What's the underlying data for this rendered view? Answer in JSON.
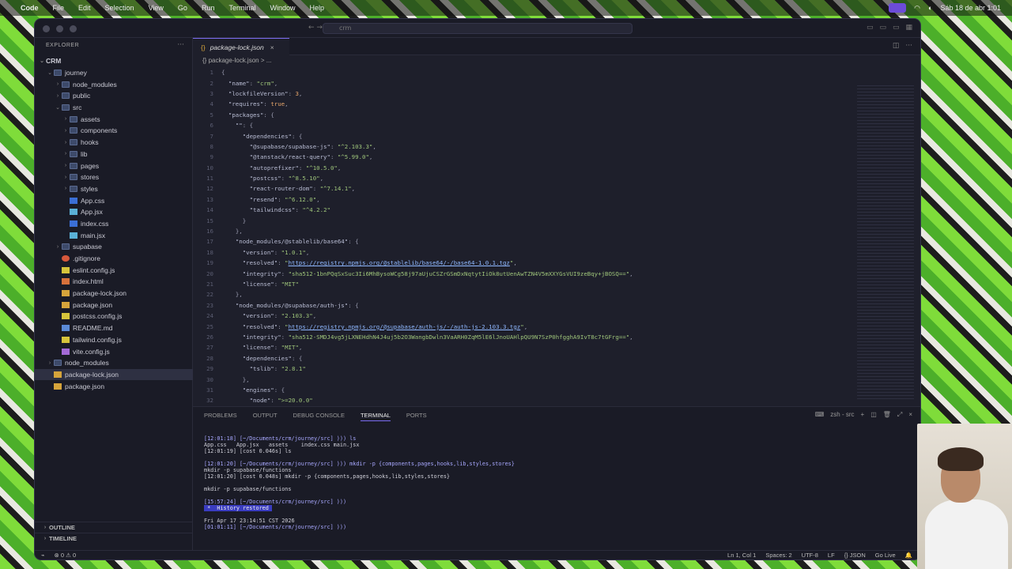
{
  "menubar": {
    "apple": "",
    "app": "Code",
    "items": [
      "File",
      "Edit",
      "Selection",
      "View",
      "Go",
      "Run",
      "Terminal",
      "Window",
      "Help"
    ],
    "clock": "Sáb 18 de abr  1:01"
  },
  "window": {
    "title": "crm",
    "nav_back": "←",
    "nav_fwd": "→"
  },
  "sidebar": {
    "header": "EXPLORER",
    "dots": "···",
    "root": "CRM",
    "rows": [
      {
        "label": "journey",
        "type": "folder",
        "depth": 1,
        "chev": "⌄"
      },
      {
        "label": "node_modules",
        "type": "folder",
        "depth": 2,
        "chev": "›"
      },
      {
        "label": "public",
        "type": "folder",
        "depth": 2,
        "chev": "›"
      },
      {
        "label": "src",
        "type": "folder",
        "depth": 2,
        "chev": "⌄"
      },
      {
        "label": "assets",
        "type": "folder",
        "depth": 3,
        "chev": "›"
      },
      {
        "label": "components",
        "type": "folder",
        "depth": 3,
        "chev": "›"
      },
      {
        "label": "hooks",
        "type": "folder",
        "depth": 3,
        "chev": "›"
      },
      {
        "label": "lib",
        "type": "folder",
        "depth": 3,
        "chev": "›"
      },
      {
        "label": "pages",
        "type": "folder",
        "depth": 3,
        "chev": "›"
      },
      {
        "label": "stores",
        "type": "folder",
        "depth": 3,
        "chev": "›"
      },
      {
        "label": "styles",
        "type": "folder",
        "depth": 3,
        "chev": "›"
      },
      {
        "label": "App.css",
        "type": "css",
        "depth": 3,
        "chev": ""
      },
      {
        "label": "App.jsx",
        "type": "jsx",
        "depth": 3,
        "chev": ""
      },
      {
        "label": "index.css",
        "type": "css",
        "depth": 3,
        "chev": ""
      },
      {
        "label": "main.jsx",
        "type": "jsx",
        "depth": 3,
        "chev": ""
      },
      {
        "label": "supabase",
        "type": "folder",
        "depth": 2,
        "chev": "›"
      },
      {
        "label": ".gitignore",
        "type": "git",
        "depth": 2,
        "chev": ""
      },
      {
        "label": "eslint.config.js",
        "type": "js",
        "depth": 2,
        "chev": ""
      },
      {
        "label": "index.html",
        "type": "html",
        "depth": 2,
        "chev": ""
      },
      {
        "label": "package-lock.json",
        "type": "json",
        "depth": 2,
        "chev": ""
      },
      {
        "label": "package.json",
        "type": "json",
        "depth": 2,
        "chev": ""
      },
      {
        "label": "postcss.config.js",
        "type": "js",
        "depth": 2,
        "chev": ""
      },
      {
        "label": "README.md",
        "type": "md",
        "depth": 2,
        "chev": ""
      },
      {
        "label": "tailwind.config.js",
        "type": "js",
        "depth": 2,
        "chev": ""
      },
      {
        "label": "vite.config.js",
        "type": "vite",
        "depth": 2,
        "chev": ""
      },
      {
        "label": "node_modules",
        "type": "folder",
        "depth": 1,
        "chev": "›"
      },
      {
        "label": "package-lock.json",
        "type": "json",
        "depth": 1,
        "chev": "",
        "selected": true
      },
      {
        "label": "package.json",
        "type": "json",
        "depth": 1,
        "chev": ""
      }
    ],
    "outline": "OUTLINE",
    "timeline": "TIMELINE"
  },
  "editor": {
    "tab_label": "package-lock.json",
    "tab_close": "×",
    "breadcrumb": "{} package-lock.json > ...",
    "lines": [
      "{",
      "  \"name\": \"crm\",",
      "  \"lockfileVersion\": 3,",
      "  \"requires\": true,",
      "  \"packages\": {",
      "    \"\": {",
      "      \"dependencies\": {",
      "        \"@supabase/supabase-js\": \"^2.103.3\",",
      "        \"@tanstack/react-query\": \"^5.99.0\",",
      "        \"autoprefixer\": \"^10.5.0\",",
      "        \"postcss\": \"^8.5.10\",",
      "        \"react-router-dom\": \"^7.14.1\",",
      "        \"resend\": \"^6.12.0\",",
      "        \"tailwindcss\": \"^4.2.2\"",
      "      }",
      "    },",
      "    \"node_modules/@stablelib/base64\": {",
      "      \"version\": \"1.0.1\",",
      "      \"resolved\": \"https://registry.npmjs.org/@stablelib/base64/-/base64-1.0.1.tgz\",",
      "      \"integrity\": \"sha512-1bnPQqSxSuc3Ii6MhBysoWCg58j97aUjuCSZrGSmDxNqtytIiOk8utUenAwTZN4V5mXXYGsVUI9zeBqy+jBOSQ==\",",
      "      \"license\": \"MIT\"",
      "    },",
      "    \"node_modules/@supabase/auth-js\": {",
      "      \"version\": \"2.103.3\",",
      "      \"resolved\": \"https://registry.npmjs.org/@supabase/auth-js/-/auth-js-2.103.3.tgz\",",
      "      \"integrity\": \"sha512-SMDJ4vg5jLXNEHdhN4J4uj5b2O3WangbDwln3VaARH0ZqM5lE6lJnoUAHlpQU9N7SzP0hfgghA9IvT8c7tGFrg==\",",
      "      \"license\": \"MIT\",",
      "      \"dependencies\": {",
      "        \"tslib\": \"2.8.1\"",
      "      },",
      "      \"engines\": {",
      "        \"node\": \">=20.0.0\""
    ]
  },
  "panel": {
    "tabs": [
      "PROBLEMS",
      "OUTPUT",
      "DEBUG CONSOLE",
      "TERMINAL",
      "PORTS"
    ],
    "active_tab": "TERMINAL",
    "shell": "zsh - src",
    "terminal": [
      {
        "t": "[12:01:18] [~/Documents/crm/journey/src] ))) ls",
        "c": "pr"
      },
      {
        "t": "App.css   App.jsx   assets    index.css main.jsx",
        "c": ""
      },
      {
        "t": "[12:01:19] [cost 0.046s] ls",
        "c": ""
      },
      {
        "t": "",
        "c": ""
      },
      {
        "t": "[12:01:20] [~/Documents/crm/journey/src] ))) mkdir -p {components,pages,hooks,lib,styles,stores}",
        "c": "pr"
      },
      {
        "t": "mkdir -p supabase/functions",
        "c": ""
      },
      {
        "t": "[12:01:20] [cost 0.048s] mkdir -p {components,pages,hooks,lib,styles,stores}",
        "c": ""
      },
      {
        "t": "",
        "c": ""
      },
      {
        "t": "mkdir -p supabase/functions",
        "c": ""
      },
      {
        "t": "",
        "c": ""
      },
      {
        "t": "[15:57:24] [~/Documents/crm/journey/src] )))",
        "c": "pr"
      },
      {
        "t": " *  History restored ",
        "c": "hl"
      },
      {
        "t": "",
        "c": ""
      },
      {
        "t": "Fri Apr 17 23:14:51 CST 2026",
        "c": ""
      },
      {
        "t": "[01:01:11] [~/Documents/crm/journey/src] )))",
        "c": "pr"
      }
    ]
  },
  "status": {
    "problems": "⊗ 0 ⚠ 0",
    "position": "Ln 1, Col 1",
    "spaces": "Spaces: 2",
    "encoding": "UTF-8",
    "eol": "LF",
    "language": "{} JSON",
    "golive": "Go Live"
  }
}
